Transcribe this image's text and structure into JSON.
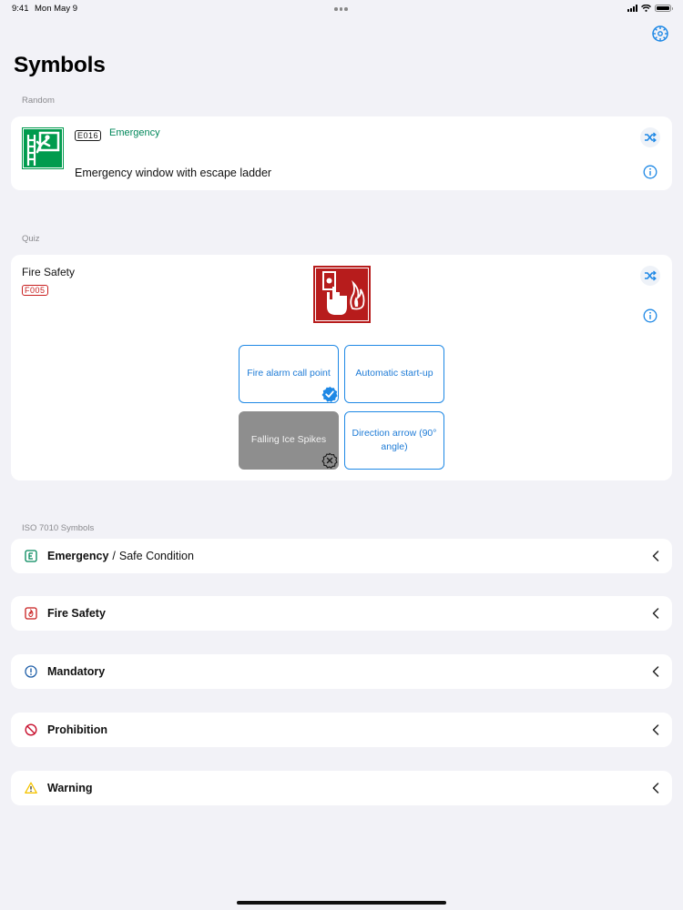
{
  "status_bar": {
    "time": "9:41",
    "date": "Mon May 9"
  },
  "page_title": "Symbols",
  "random": {
    "header": "Random",
    "code": "E016",
    "category": "Emergency",
    "name": "Emergency window with escape ladder"
  },
  "quiz": {
    "header": "Quiz",
    "title": "Fire Safety",
    "code": "F005",
    "answers": [
      {
        "label": "Fire alarm call point",
        "state": "correct"
      },
      {
        "label": "Automatic start-up",
        "state": "neutral"
      },
      {
        "label": "Falling Ice Spikes",
        "state": "wrong"
      },
      {
        "label": "Direction arrow (90° angle)",
        "state": "neutral"
      }
    ]
  },
  "iso": {
    "header": "ISO 7010 Symbols",
    "categories": [
      {
        "label": "Emergency",
        "sublabel": "Safe Condition",
        "separator": "/",
        "icon": "emergency-icon"
      },
      {
        "label": "Fire Safety",
        "icon": "fire-safety-icon"
      },
      {
        "label": "Mandatory",
        "icon": "mandatory-icon"
      },
      {
        "label": "Prohibition",
        "icon": "prohibition-icon"
      },
      {
        "label": "Warning",
        "icon": "warning-icon"
      }
    ]
  },
  "colors": {
    "accent": "#1e88e5",
    "emergency": "#00875a",
    "fire": "#c81e1e",
    "mandatory": "#1f5fa8",
    "prohibition": "#c8102e",
    "warning": "#f5c400",
    "background": "#f2f2f7"
  }
}
